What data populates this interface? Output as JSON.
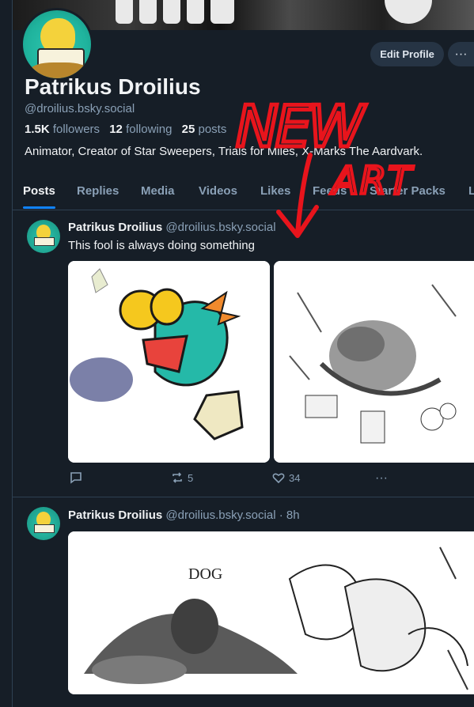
{
  "profile": {
    "display_name": "Patrikus Droilius",
    "handle": "@droilius.bsky.social",
    "followers_count": "1.5K",
    "followers_label": "followers",
    "following_count": "12",
    "following_label": "following",
    "posts_count": "25",
    "posts_label": "posts",
    "bio": "Animator, Creator of Star Sweepers, Trials for Miles, X-Marks The Aardvark.",
    "edit_label": "Edit Profile",
    "more_label": "···"
  },
  "tabs": [
    "Posts",
    "Replies",
    "Media",
    "Videos",
    "Likes",
    "Feeds",
    "Starter Packs",
    "L"
  ],
  "posts": [
    {
      "author": "Patrikus Droilius",
      "handle": "@droilius.bsky.social",
      "text": "This fool is always doing something",
      "replies": "",
      "reposts": "5",
      "likes": "34",
      "more": "···"
    },
    {
      "author": "Patrikus Droilius",
      "handle": "@droilius.bsky.social · 8h",
      "image_caption": "DOG"
    }
  ],
  "overlay": {
    "text_line1": "NEW",
    "text_line2": "ART",
    "color": "#e8141c"
  },
  "colors": {
    "background": "#161e27",
    "accent": "#1083fe",
    "muted": "#8aa0b6",
    "button": "#263444"
  }
}
